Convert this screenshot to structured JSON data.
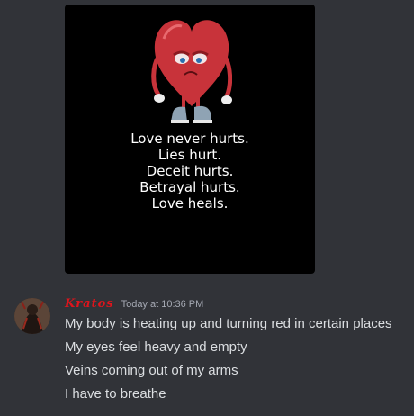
{
  "attachment": {
    "alt": "sad heart cartoon image",
    "poem_lines": [
      "Love never hurts.",
      "Lies hurt.",
      "Deceit hurts.",
      "Betrayal hurts.",
      "Love heals."
    ]
  },
  "message": {
    "username": "Kratos",
    "timestamp": "Today at 10:36 PM",
    "lines": [
      "My body is heating up and turning red in certain places",
      "My eyes feel heavy and empty",
      "Veins coming out of my arms",
      "I have to breathe"
    ]
  },
  "colors": {
    "background": "#313338",
    "username": "#e0141c",
    "message_text": "#dbdee1",
    "timestamp": "#a5a9b3"
  }
}
